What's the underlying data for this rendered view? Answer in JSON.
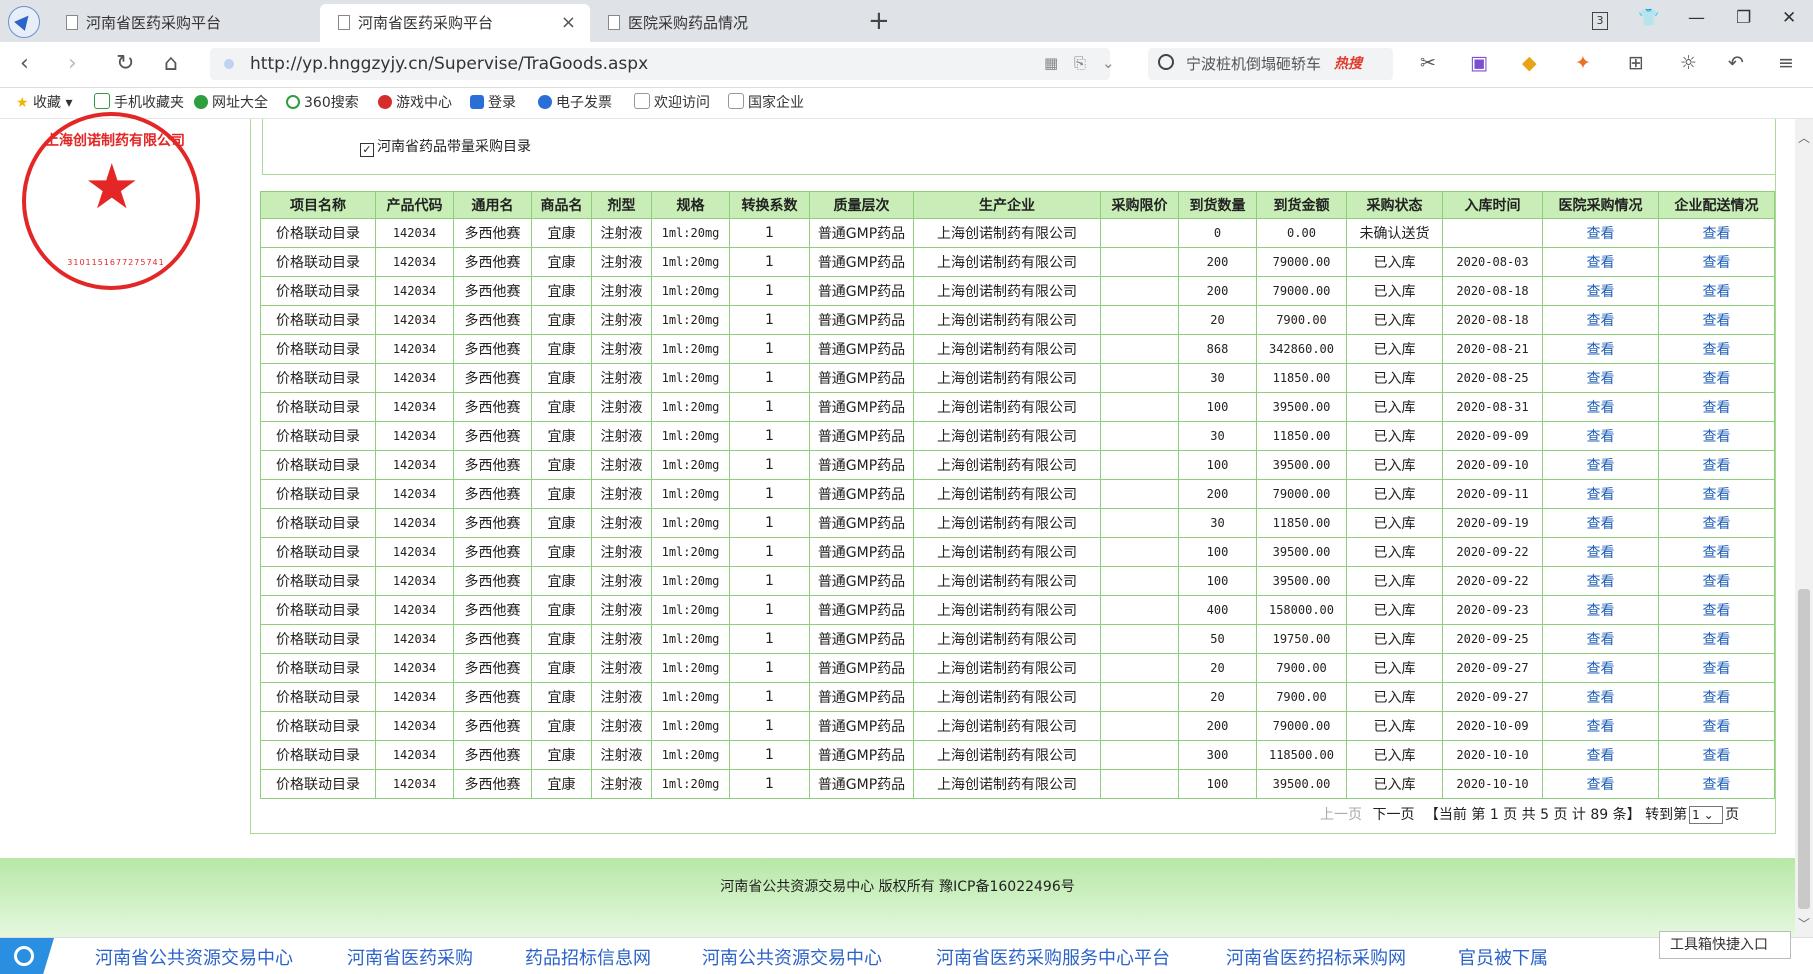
{
  "tabs": [
    {
      "label": "河南省医药采购平台",
      "active": false
    },
    {
      "label": "河南省医药采购平台",
      "active": true
    },
    {
      "label": "医院采购药品情况",
      "active": false
    }
  ],
  "window_controls": {
    "badge": "3"
  },
  "address": {
    "url": "http://yp.hnggzyjy.cn/Supervise/TraGoods.aspx"
  },
  "search": {
    "text": "宁波桩机倒塌砸轿车",
    "hot": "热搜"
  },
  "bookmarks": [
    "收藏",
    "手机收藏夹",
    "网址大全",
    "360搜索",
    "游戏中心",
    "登录",
    "电子发票",
    "欢迎访问",
    "国家企业"
  ],
  "stamp": {
    "text": "上海创诺制药有限公司",
    "number": "3101151677275741"
  },
  "filter": {
    "checkbox_label": "河南省药品带量采购目录",
    "checked": true
  },
  "table": {
    "headers": [
      "项目名称",
      "产品代码",
      "通用名",
      "商品名",
      "剂型",
      "规格",
      "转换系数",
      "质量层次",
      "生产企业",
      "采购限价",
      "到货数量",
      "到货金额",
      "采购状态",
      "入库时间",
      "医院采购情况",
      "企业配送情况"
    ],
    "rows": [
      [
        "价格联动目录",
        "142034",
        "多西他赛",
        "宜康",
        "注射液",
        "1ml:20mg",
        "1",
        "普通GMP药品",
        "上海创诺制药有限公司",
        "",
        "0",
        "0.00",
        "未确认送货",
        "",
        "查看",
        "查看"
      ],
      [
        "价格联动目录",
        "142034",
        "多西他赛",
        "宜康",
        "注射液",
        "1ml:20mg",
        "1",
        "普通GMP药品",
        "上海创诺制药有限公司",
        "",
        "200",
        "79000.00",
        "已入库",
        "2020-08-03",
        "查看",
        "查看"
      ],
      [
        "价格联动目录",
        "142034",
        "多西他赛",
        "宜康",
        "注射液",
        "1ml:20mg",
        "1",
        "普通GMP药品",
        "上海创诺制药有限公司",
        "",
        "200",
        "79000.00",
        "已入库",
        "2020-08-18",
        "查看",
        "查看"
      ],
      [
        "价格联动目录",
        "142034",
        "多西他赛",
        "宜康",
        "注射液",
        "1ml:20mg",
        "1",
        "普通GMP药品",
        "上海创诺制药有限公司",
        "",
        "20",
        "7900.00",
        "已入库",
        "2020-08-18",
        "查看",
        "查看"
      ],
      [
        "价格联动目录",
        "142034",
        "多西他赛",
        "宜康",
        "注射液",
        "1ml:20mg",
        "1",
        "普通GMP药品",
        "上海创诺制药有限公司",
        "",
        "868",
        "342860.00",
        "已入库",
        "2020-08-21",
        "查看",
        "查看"
      ],
      [
        "价格联动目录",
        "142034",
        "多西他赛",
        "宜康",
        "注射液",
        "1ml:20mg",
        "1",
        "普通GMP药品",
        "上海创诺制药有限公司",
        "",
        "30",
        "11850.00",
        "已入库",
        "2020-08-25",
        "查看",
        "查看"
      ],
      [
        "价格联动目录",
        "142034",
        "多西他赛",
        "宜康",
        "注射液",
        "1ml:20mg",
        "1",
        "普通GMP药品",
        "上海创诺制药有限公司",
        "",
        "100",
        "39500.00",
        "已入库",
        "2020-08-31",
        "查看",
        "查看"
      ],
      [
        "价格联动目录",
        "142034",
        "多西他赛",
        "宜康",
        "注射液",
        "1ml:20mg",
        "1",
        "普通GMP药品",
        "上海创诺制药有限公司",
        "",
        "30",
        "11850.00",
        "已入库",
        "2020-09-09",
        "查看",
        "查看"
      ],
      [
        "价格联动目录",
        "142034",
        "多西他赛",
        "宜康",
        "注射液",
        "1ml:20mg",
        "1",
        "普通GMP药品",
        "上海创诺制药有限公司",
        "",
        "100",
        "39500.00",
        "已入库",
        "2020-09-10",
        "查看",
        "查看"
      ],
      [
        "价格联动目录",
        "142034",
        "多西他赛",
        "宜康",
        "注射液",
        "1ml:20mg",
        "1",
        "普通GMP药品",
        "上海创诺制药有限公司",
        "",
        "200",
        "79000.00",
        "已入库",
        "2020-09-11",
        "查看",
        "查看"
      ],
      [
        "价格联动目录",
        "142034",
        "多西他赛",
        "宜康",
        "注射液",
        "1ml:20mg",
        "1",
        "普通GMP药品",
        "上海创诺制药有限公司",
        "",
        "30",
        "11850.00",
        "已入库",
        "2020-09-19",
        "查看",
        "查看"
      ],
      [
        "价格联动目录",
        "142034",
        "多西他赛",
        "宜康",
        "注射液",
        "1ml:20mg",
        "1",
        "普通GMP药品",
        "上海创诺制药有限公司",
        "",
        "100",
        "39500.00",
        "已入库",
        "2020-09-22",
        "查看",
        "查看"
      ],
      [
        "价格联动目录",
        "142034",
        "多西他赛",
        "宜康",
        "注射液",
        "1ml:20mg",
        "1",
        "普通GMP药品",
        "上海创诺制药有限公司",
        "",
        "100",
        "39500.00",
        "已入库",
        "2020-09-22",
        "查看",
        "查看"
      ],
      [
        "价格联动目录",
        "142034",
        "多西他赛",
        "宜康",
        "注射液",
        "1ml:20mg",
        "1",
        "普通GMP药品",
        "上海创诺制药有限公司",
        "",
        "400",
        "158000.00",
        "已入库",
        "2020-09-23",
        "查看",
        "查看"
      ],
      [
        "价格联动目录",
        "142034",
        "多西他赛",
        "宜康",
        "注射液",
        "1ml:20mg",
        "1",
        "普通GMP药品",
        "上海创诺制药有限公司",
        "",
        "50",
        "19750.00",
        "已入库",
        "2020-09-25",
        "查看",
        "查看"
      ],
      [
        "价格联动目录",
        "142034",
        "多西他赛",
        "宜康",
        "注射液",
        "1ml:20mg",
        "1",
        "普通GMP药品",
        "上海创诺制药有限公司",
        "",
        "20",
        "7900.00",
        "已入库",
        "2020-09-27",
        "查看",
        "查看"
      ],
      [
        "价格联动目录",
        "142034",
        "多西他赛",
        "宜康",
        "注射液",
        "1ml:20mg",
        "1",
        "普通GMP药品",
        "上海创诺制药有限公司",
        "",
        "20",
        "7900.00",
        "已入库",
        "2020-09-27",
        "查看",
        "查看"
      ],
      [
        "价格联动目录",
        "142034",
        "多西他赛",
        "宜康",
        "注射液",
        "1ml:20mg",
        "1",
        "普通GMP药品",
        "上海创诺制药有限公司",
        "",
        "200",
        "79000.00",
        "已入库",
        "2020-10-09",
        "查看",
        "查看"
      ],
      [
        "价格联动目录",
        "142034",
        "多西他赛",
        "宜康",
        "注射液",
        "1ml:20mg",
        "1",
        "普通GMP药品",
        "上海创诺制药有限公司",
        "",
        "300",
        "118500.00",
        "已入库",
        "2020-10-10",
        "查看",
        "查看"
      ],
      [
        "价格联动目录",
        "142034",
        "多西他赛",
        "宜康",
        "注射液",
        "1ml:20mg",
        "1",
        "普通GMP药品",
        "上海创诺制药有限公司",
        "",
        "100",
        "39500.00",
        "已入库",
        "2020-10-10",
        "查看",
        "查看"
      ]
    ]
  },
  "pager": {
    "prev": "上一页",
    "next": "下一页",
    "info_a": "【当前 第",
    "current": "1",
    "info_b": "页 共",
    "total_pages": "5",
    "info_c": "页 计",
    "total_records": "89",
    "info_d": "条】 转到第",
    "goto_value": "1",
    "info_e": "页"
  },
  "footer": {
    "text": "河南省公共资源交易中心 版权所有 豫ICP备16022496号"
  },
  "bottom_links": [
    "河南省公共资源交易中心",
    "河南省医药采购",
    "药品招标信息网",
    "河南公共资源交易中心",
    "河南省医药采购服务中心平台",
    "河南省医药招标采购网",
    "官员被下属"
  ],
  "toolbox": {
    "label": "工具箱快捷入口"
  },
  "colors": {
    "header_bg": "#c8edb6",
    "border": "#8fcf7c",
    "link": "#1f5fb8",
    "stamp": "#e32626"
  }
}
